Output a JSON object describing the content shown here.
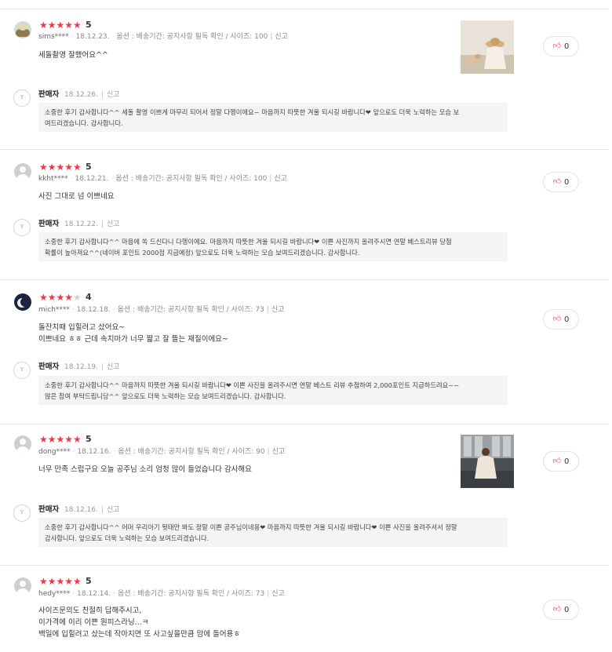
{
  "reviews": [
    {
      "stars": 5,
      "score": "5",
      "user": "sims****",
      "date": "18.12.23.",
      "option": "옵션 : 배송기간: 공지사항 필독 확인 / 사이즈: 100",
      "report": "신고",
      "text": [
        "세돌촬영 잘했어요^^"
      ],
      "has_photo": true,
      "likes": "0",
      "reply": {
        "name": "판매자",
        "date": "18.12.26.",
        "report": "신고",
        "text": "소중한 후기 감사합니다^^ 세돌 촬영 이쁘게 마무리 되어서 정말 다행이에요~ 마음까지 따뜻한 겨울 되시길 바랍니다❤ 앞으로도 더욱 노력하는 모습 보\n여드리겠습니다. 감사합니다."
      }
    },
    {
      "stars": 5,
      "score": "5",
      "user": "kkht****",
      "date": "18.12.21.",
      "option": "옵션 : 배송기간: 공지사항 필독 확인 / 사이즈: 100",
      "report": "신고",
      "text": [
        "사진 그대로 넘 이쁘네요"
      ],
      "has_photo": false,
      "likes": "0",
      "reply": {
        "name": "판매자",
        "date": "18.12.22.",
        "report": "신고",
        "text": "소중한 후기 감사합니다^^ 마음에 쏙 드신다니 다행이에요. 마음까지 따뜻한 겨울 되시길 바랍니다❤ 이쁜 사진까지 올려주시면 연말 베스트리뷰 당첨\n확률이 높아져요^^(네이버 포인트 2000점 지급예정) 앞으로도 더욱 노력하는 모습 보여드리겠습니다. 감사합니다."
      }
    },
    {
      "stars": 4,
      "score": "4",
      "user": "mich****",
      "date": "18.12.18.",
      "option": "옵션 : 배송기간: 공지사항 필독 확인 / 사이즈: 73",
      "report": "신고",
      "text": [
        "돌잔치때 입힐려고 샀어요~",
        "이쁘네요 ㅎㅎ 근데 속치마가 너무 짧고 잘 뜰는 재질이에요~"
      ],
      "has_photo": false,
      "likes": "0",
      "reply": {
        "name": "판매자",
        "date": "18.12.19.",
        "report": "신고",
        "text": "소중한 후기 감사합니다^^ 마음까지 따뜻한 겨울 되시길 바랍니다❤ 이쁜 사진을 올려주시면 연말 베스트 리뷰 추첨하여 2,000포인트 지급하드려요~~\n많은 참여 부탁드립니당^^ 앞으로도 더욱 노력하는 모습 보여드리겠습니다. 감사합니다."
      }
    },
    {
      "stars": 5,
      "score": "5",
      "user": "dong****",
      "date": "18.12.16.",
      "option": "옵션 : 배송기간: 공지사항 필독 확인 / 사이즈: 90",
      "report": "신고",
      "text": [
        "너무 만족 스럽구요 오늘 공주님 소리 엄청 많이 들었습니다 감사해요"
      ],
      "has_photo": true,
      "likes": "0",
      "reply": {
        "name": "판매자",
        "date": "18.12.16.",
        "report": "신고",
        "text": "소중한 후기 감사합니다^^ 어머 우리아기 뒷태만 봐도 정말 이쁜 공주님이네용❤ 마음까지 따뜻한 겨울 되시길 바랍니다❤ 이쁜 사진을 올려주셔서 정말\n감사합니다. 앞으로도 더욱 노력하는 모습 보여드리겠습니다."
      }
    },
    {
      "stars": 5,
      "score": "5",
      "user": "hedy****",
      "date": "18.12.14.",
      "option": "옵션 : 배송기간: 공지사항 필독 확인 / 사이즈: 73",
      "report": "신고",
      "text": [
        "사이즈문의도 친절히 답해주시고,",
        "이가격에 이리 이쁜 원피스라닝...ㅋ",
        "백일에 입힐려고 샀는데 작아지면 또 사고싶을만큼 맘에 들어용ㅎ"
      ],
      "has_photo": false,
      "likes": "0"
    }
  ],
  "seller_logo_text": "Y"
}
